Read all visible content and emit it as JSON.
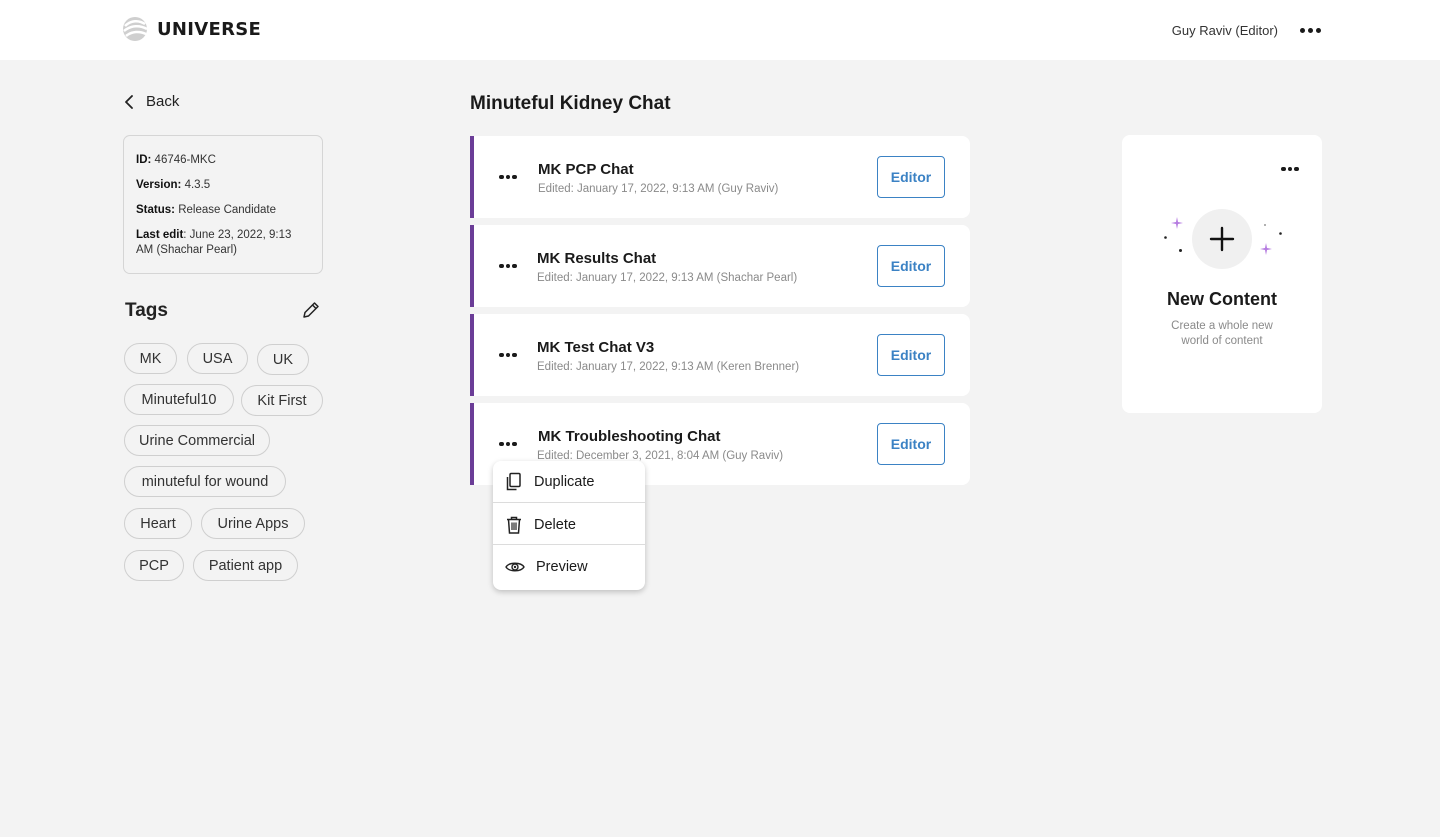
{
  "header": {
    "brand": "UNIVERSE",
    "user": "Guy Raviv (Editor)"
  },
  "sidebar": {
    "back_label": "Back",
    "info": {
      "id_label": "ID:",
      "id_value": "46746-MKC",
      "version_label": "Version:",
      "version_value": "4.3.5",
      "status_label": "Status:",
      "status_value": "Release Candidate",
      "last_edit_label": "Last edit",
      "last_edit_value": ": June 23, 2022, 9:13 AM (Shachar Pearl)"
    },
    "tags_title": "Tags",
    "tags": [
      "MK",
      "USA",
      "UK",
      "Minuteful10",
      "Kit First",
      "Urine Commercial",
      "minuteful for wound",
      "Heart",
      "Urine Apps",
      "PCP",
      "Patient app"
    ]
  },
  "main": {
    "title": "Minuteful Kidney Chat",
    "items": [
      {
        "title": "MK PCP Chat",
        "edited": "Edited: January 17, 2022, 9:13 AM (Guy Raviv)",
        "button": "Editor"
      },
      {
        "title": "MK Results Chat",
        "edited": "Edited: January 17, 2022, 9:13 AM (Shachar Pearl)",
        "button": "Editor"
      },
      {
        "title": "MK Test Chat V3",
        "edited": "Edited: January 17, 2022, 9:13 AM (Keren Brenner)",
        "button": "Editor"
      },
      {
        "title": "MK Troubleshooting Chat",
        "edited": "Edited: December 3, 2021, 8:04 AM (Guy Raviv)",
        "button": "Editor"
      }
    ],
    "context_menu": [
      "Duplicate",
      "Delete",
      "Preview"
    ]
  },
  "new_content": {
    "title": "New Content",
    "subtitle": "Create a whole new world of content"
  },
  "colors": {
    "accent_border": "#6b3d97",
    "editor_blue": "#3b82c4",
    "sparkle_purple": "#b57be0"
  }
}
